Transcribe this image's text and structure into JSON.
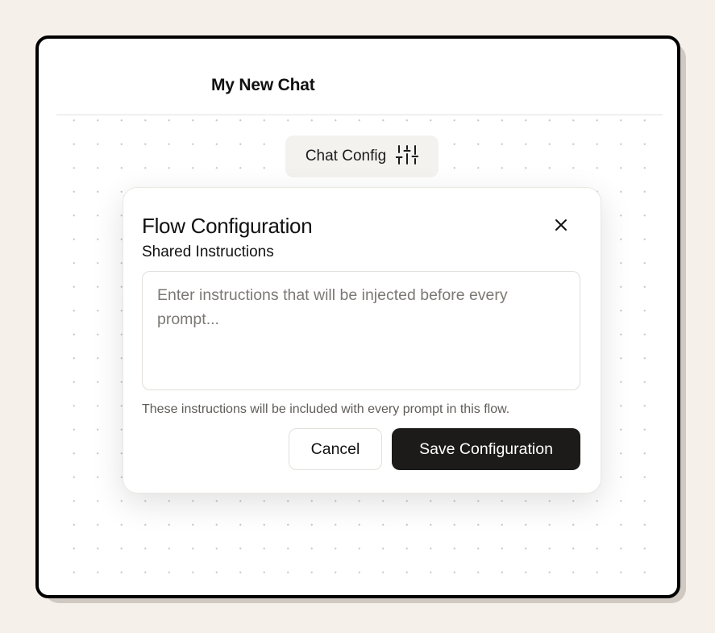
{
  "chat": {
    "title": "My New Chat"
  },
  "toolbar": {
    "config_label": "Chat Config",
    "config_icon": "sliders-icon"
  },
  "modal": {
    "title": "Flow Configuration",
    "close_icon": "close-icon",
    "field_label": "Shared Instructions",
    "textarea_value": "",
    "textarea_placeholder": "Enter instructions that will be injected before every prompt...",
    "help_text": "These instructions will be included with every prompt in this flow.",
    "cancel_label": "Cancel",
    "save_label": "Save Configuration"
  },
  "colors": {
    "page_background": "#f6f0ea",
    "primary_button": "#1c1b19",
    "window_border": "#000000"
  }
}
